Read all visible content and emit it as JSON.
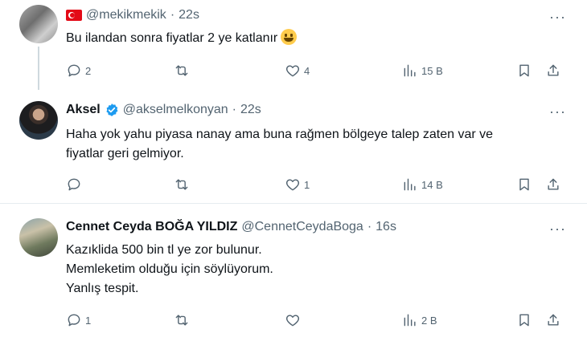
{
  "tweets": [
    {
      "name": "",
      "handle": "@mekikmekik",
      "separator": "·",
      "time": "22s",
      "text": "Bu ilandan sonra fiyatlar 2 ye katlanır",
      "emoji": "grinning-face-icon",
      "flag": "turkey-flag-icon",
      "replies": "2",
      "retweets": "",
      "likes": "4",
      "views": "15 B"
    },
    {
      "name": "Aksel",
      "handle": "@akselmelkonyan",
      "separator": "·",
      "time": "22s",
      "verified": true,
      "text_lines": [
        "Haha yok yahu piyasa nanay ama buna rağmen bölgeye talep zaten var ve",
        "fiyatlar geri gelmiyor."
      ],
      "replies": "",
      "retweets": "",
      "likes": "1",
      "views": "14 B"
    },
    {
      "name": "Cennet Ceyda BOĞA YILDIZ",
      "handle": "@CennetCeydaBoga",
      "separator": "·",
      "time": "16s",
      "text_lines": [
        "Kazıklida 500 bin tl ye zor bulunur.",
        "Memleketim olduğu için söylüyorum.",
        "Yanlış tespit."
      ],
      "replies": "1",
      "retweets": "",
      "likes": "",
      "views": "2 B"
    }
  ],
  "more_label": "···",
  "colors": {
    "text": "#0f1419",
    "muted": "#536471",
    "verified": "#1d9bf0",
    "divider": "#e6ecf0"
  }
}
